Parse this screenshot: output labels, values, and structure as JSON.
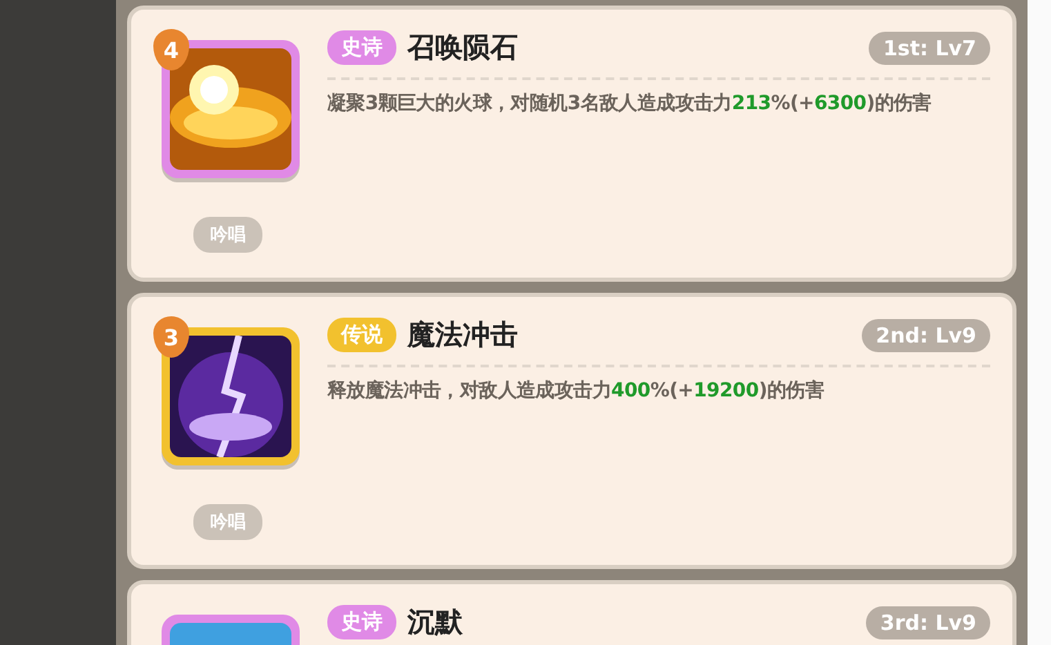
{
  "skills": [
    {
      "rarity": "史诗",
      "color": "#e08ae6",
      "kind": "fire",
      "name": "召唤陨石",
      "rank": "1st: Lv7",
      "cost": "4",
      "description": [
        {
          "text": "凝聚3颗巨大的火球，对随机3名敌人造成攻击力",
          "highlight": false
        },
        {
          "text": "213",
          "highlight": true
        },
        {
          "text": "%(+",
          "highlight": false
        },
        {
          "text": "6300",
          "highlight": true
        },
        {
          "text": ")的伤害",
          "highlight": false
        }
      ],
      "tag": "吟唱"
    },
    {
      "rarity": "传说",
      "color": "#f2c12e",
      "kind": "arcane",
      "name": "魔法冲击",
      "rank": "2nd: Lv9",
      "cost": "3",
      "description": [
        {
          "text": "释放魔法冲击，对敌人造成攻击力",
          "highlight": false
        },
        {
          "text": "400",
          "highlight": true
        },
        {
          "text": "%(+",
          "highlight": false
        },
        {
          "text": "19200",
          "highlight": true
        },
        {
          "text": ")的伤害",
          "highlight": false
        }
      ],
      "tag": "吟唱"
    },
    {
      "rarity": "史诗",
      "color": "#e08ae6",
      "kind": "silence",
      "name": "沉默",
      "rank": "3rd: Lv9"
    }
  ]
}
